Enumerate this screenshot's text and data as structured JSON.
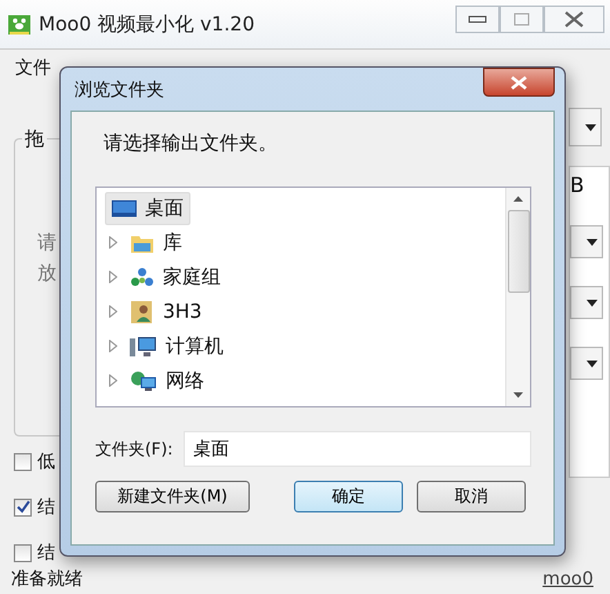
{
  "window": {
    "title": "Moo0 视频最小化 v1.20"
  },
  "menu": [
    {
      "label": "文件"
    }
  ],
  "group": {
    "title": "拖",
    "lines": [
      "请",
      "放"
    ]
  },
  "side_text": "B",
  "options": [
    {
      "label": "低",
      "checked": false
    },
    {
      "label": "结",
      "checked": true
    },
    {
      "label": "结",
      "checked": false
    }
  ],
  "status_bar": {
    "text": "准备就绪",
    "link": "moo0"
  },
  "dialog": {
    "title": "浏览文件夹",
    "prompt": "请选择输出文件夹。",
    "tree": [
      {
        "label": "桌面",
        "kind": "desktop",
        "selected": true,
        "children": [
          {
            "label": "库",
            "kind": "library",
            "selected": false,
            "expanded": false
          },
          {
            "label": "家庭组",
            "kind": "homegroup",
            "selected": false,
            "expanded": false
          },
          {
            "label": "3H3",
            "kind": "user",
            "selected": false,
            "expanded": false
          },
          {
            "label": "计算机",
            "kind": "computer",
            "selected": false,
            "expanded": false
          },
          {
            "label": "网络",
            "kind": "network",
            "selected": false,
            "expanded": false
          }
        ]
      }
    ],
    "folder_label": "文件夹(F):",
    "folder_value": "桌面",
    "buttons": [
      {
        "label": "新建文件夹(M)",
        "default": false
      },
      {
        "label": "确定",
        "default": true
      },
      {
        "label": "取消",
        "default": false
      }
    ]
  }
}
